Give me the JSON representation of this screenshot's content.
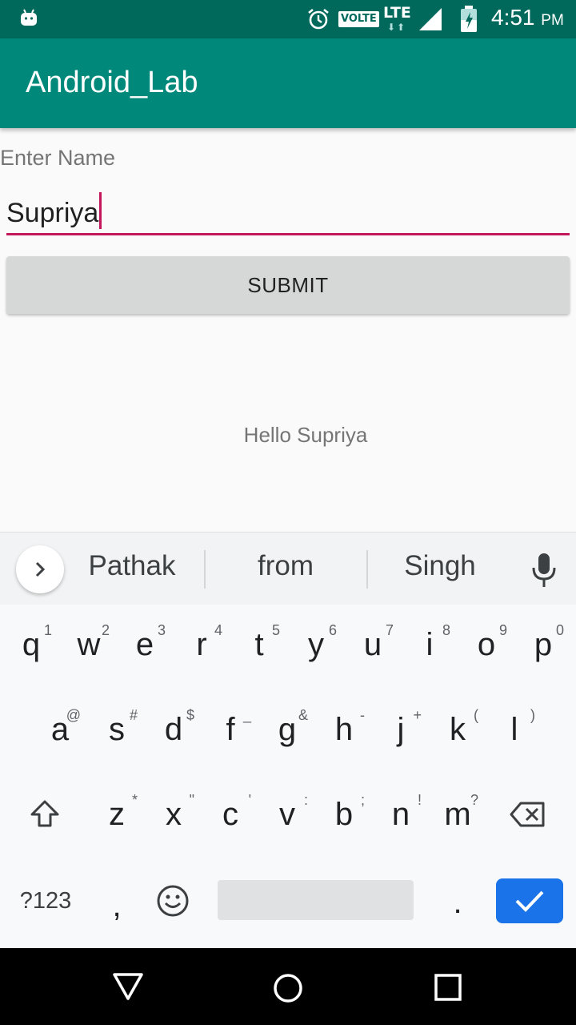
{
  "status_bar": {
    "volte": "VOLTE",
    "network": "LTE",
    "time": "4:51",
    "ampm": "PM",
    "icons": [
      "android-icon",
      "alarm-icon",
      "signal-icon",
      "battery-icon"
    ]
  },
  "app_bar": {
    "title": "Android_Lab"
  },
  "form": {
    "label": "Enter Name",
    "name_value": "Supriya",
    "submit_label": "SUBMIT",
    "output": "Hello Supriya"
  },
  "keyboard": {
    "suggestions": [
      "Pathak",
      "from",
      "Singh"
    ],
    "row1": [
      {
        "k": "q",
        "h": "1"
      },
      {
        "k": "w",
        "h": "2"
      },
      {
        "k": "e",
        "h": "3"
      },
      {
        "k": "r",
        "h": "4"
      },
      {
        "k": "t",
        "h": "5"
      },
      {
        "k": "y",
        "h": "6"
      },
      {
        "k": "u",
        "h": "7"
      },
      {
        "k": "i",
        "h": "8"
      },
      {
        "k": "o",
        "h": "9"
      },
      {
        "k": "p",
        "h": "0"
      }
    ],
    "row2": [
      {
        "k": "a",
        "h": "@"
      },
      {
        "k": "s",
        "h": "#"
      },
      {
        "k": "d",
        "h": "$"
      },
      {
        "k": "f",
        "h": "_"
      },
      {
        "k": "g",
        "h": "&"
      },
      {
        "k": "h",
        "h": "-"
      },
      {
        "k": "j",
        "h": "+"
      },
      {
        "k": "k",
        "h": "("
      },
      {
        "k": "l",
        "h": ")"
      }
    ],
    "row3": [
      {
        "k": "z",
        "h": "*"
      },
      {
        "k": "x",
        "h": "\""
      },
      {
        "k": "c",
        "h": "'"
      },
      {
        "k": "v",
        "h": ":"
      },
      {
        "k": "b",
        "h": ";"
      },
      {
        "k": "n",
        "h": "!"
      },
      {
        "k": "m",
        "h": "?"
      }
    ],
    "symbols_label": "?123",
    "comma": ",",
    "period": ".",
    "accent_color": "#1a73e8"
  },
  "colors": {
    "status_bar": "#00695c",
    "app_bar": "#00897b",
    "accent": "#c2185b"
  }
}
